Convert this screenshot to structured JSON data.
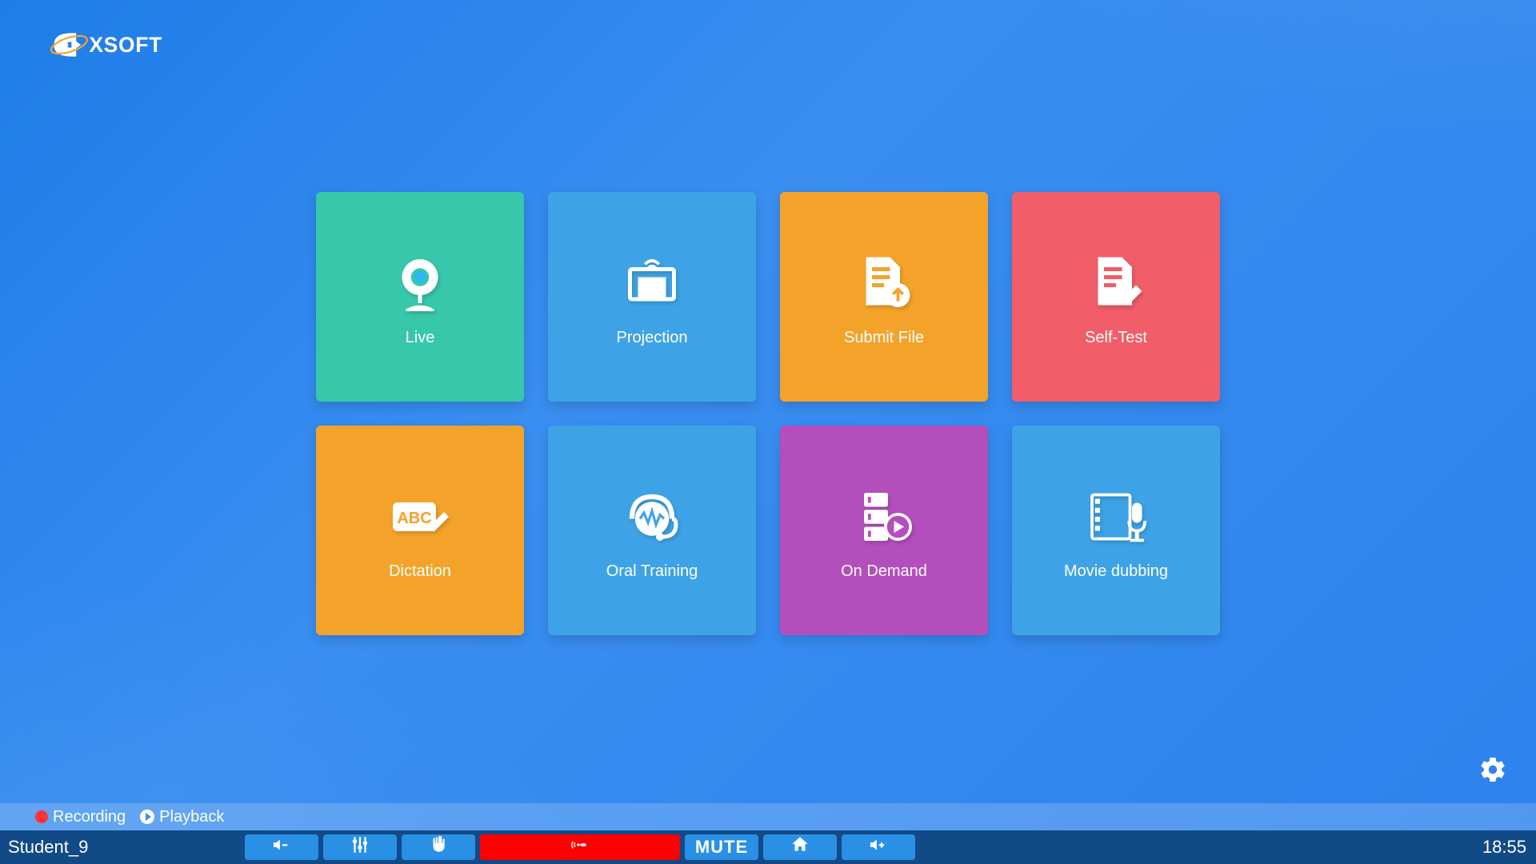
{
  "brand": "EXSOFT",
  "tiles": [
    {
      "label": "Live"
    },
    {
      "label": "Projection"
    },
    {
      "label": "Submit File"
    },
    {
      "label": "Self-Test"
    },
    {
      "label": "Dictation"
    },
    {
      "label": "Oral Training"
    },
    {
      "label": "On Demand"
    },
    {
      "label": "Movie dubbing"
    }
  ],
  "subbar": {
    "recording": "Recording",
    "playback": "Playback"
  },
  "bottombar": {
    "student": "Student_9",
    "mute": "MUTE",
    "time": "18:55"
  }
}
